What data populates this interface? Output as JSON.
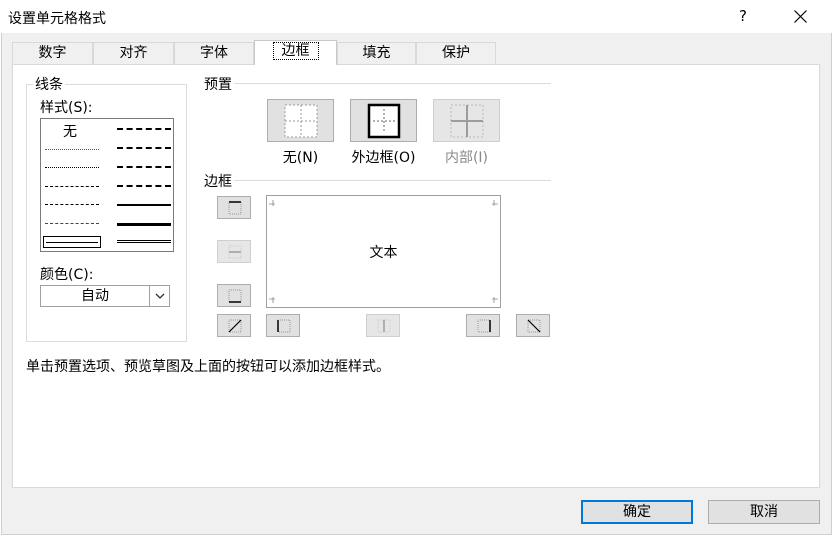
{
  "window": {
    "title": "设置单元格格式",
    "help_label": "?"
  },
  "tabs": [
    {
      "label": "数字"
    },
    {
      "label": "对齐"
    },
    {
      "label": "字体"
    },
    {
      "label": "边框",
      "active": true
    },
    {
      "label": "填充"
    },
    {
      "label": "保护"
    }
  ],
  "line": {
    "group_label": "线条",
    "style_label": "样式(S):",
    "style_none": "无",
    "color_label": "颜色(C):",
    "color_value": "自动"
  },
  "presets": {
    "group_label": "预置",
    "items": [
      {
        "label": "无(N)",
        "icon": "no-border-icon",
        "enabled": true
      },
      {
        "label": "外边框(O)",
        "icon": "outline-border-icon",
        "enabled": true
      },
      {
        "label": "内部(I)",
        "icon": "inside-border-icon",
        "enabled": false
      }
    ]
  },
  "border": {
    "group_label": "边框",
    "preview_text": "文本"
  },
  "hint": "单击预置选项、预览草图及上面的按钮可以添加边框样式。",
  "buttons": {
    "ok": "确定",
    "cancel": "取消"
  },
  "colors": {
    "accent": "#0078d7",
    "disabled_text": "#8a8a8a"
  }
}
